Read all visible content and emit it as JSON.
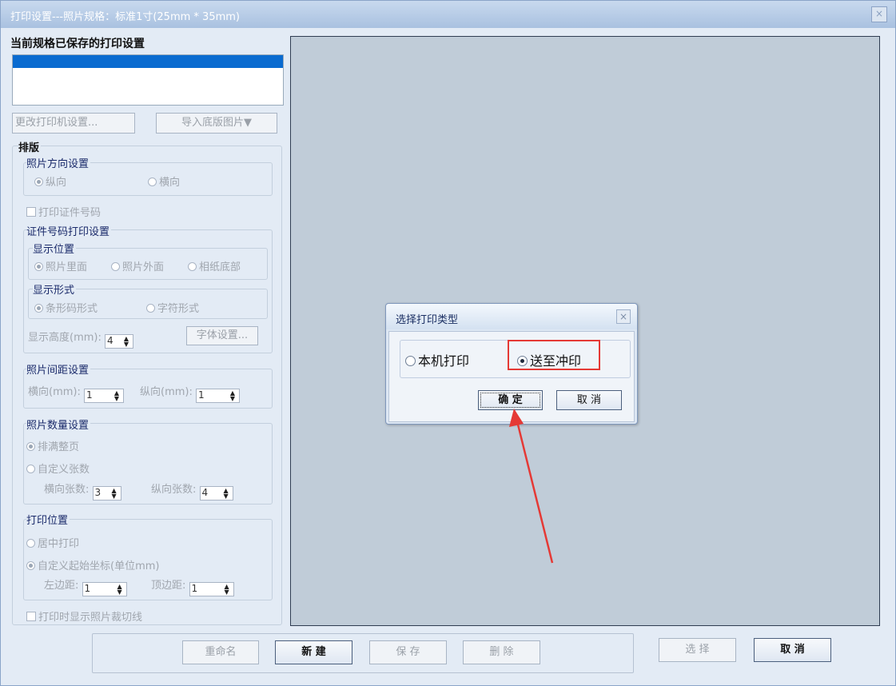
{
  "window": {
    "title": "打印设置---照片规格：标准1寸(25mm * 35mm)",
    "close_glyph": "×"
  },
  "left": {
    "saved_label": "当前规格已保存的打印设置",
    "change_printer": "更改打印机设置...",
    "import_bg": "导入底版图片▼",
    "layout_title": "排版",
    "orientation": {
      "label": "照片方向设置",
      "portrait": "纵向",
      "landscape": "横向"
    },
    "print_id": "打印证件号码",
    "id_settings": {
      "label": "证件号码打印设置",
      "position_label": "显示位置",
      "inside": "照片里面",
      "outside": "照片外面",
      "bottom": "相纸底部",
      "form_label": "显示形式",
      "barcode": "条形码形式",
      "chars": "字符形式",
      "height_label": "显示高度(mm):",
      "height_value": "4",
      "font_button": "字体设置..."
    },
    "spacing": {
      "label": "照片间距设置",
      "h_label": "横向(mm):",
      "h_value": "1",
      "v_label": "纵向(mm):",
      "v_value": "1"
    },
    "quantity": {
      "label": "照片数量设置",
      "fill": "排满整页",
      "custom": "自定义张数",
      "h_label": "横向张数:",
      "h_value": "3",
      "v_label": "纵向张数:",
      "v_value": "4"
    },
    "position": {
      "label": "打印位置",
      "center": "居中打印",
      "custom": "自定义起始坐标(单位mm)",
      "left_label": "左边距:",
      "left_value": "1",
      "top_label": "顶边距:",
      "top_value": "1"
    },
    "show_cut": "打印时显示照片裁切线"
  },
  "footer": {
    "rename": "重命名",
    "new": "新  建",
    "save": "保  存",
    "delete": "删  除",
    "select": "选  择",
    "cancel": "取  消"
  },
  "dialog": {
    "title": "选择打印类型",
    "local": "本机打印",
    "send": "送至冲印",
    "ok": "确  定",
    "cancel": "取  消"
  },
  "colors": {
    "annotation": "#e53935",
    "selection": "#0a6bd0"
  }
}
